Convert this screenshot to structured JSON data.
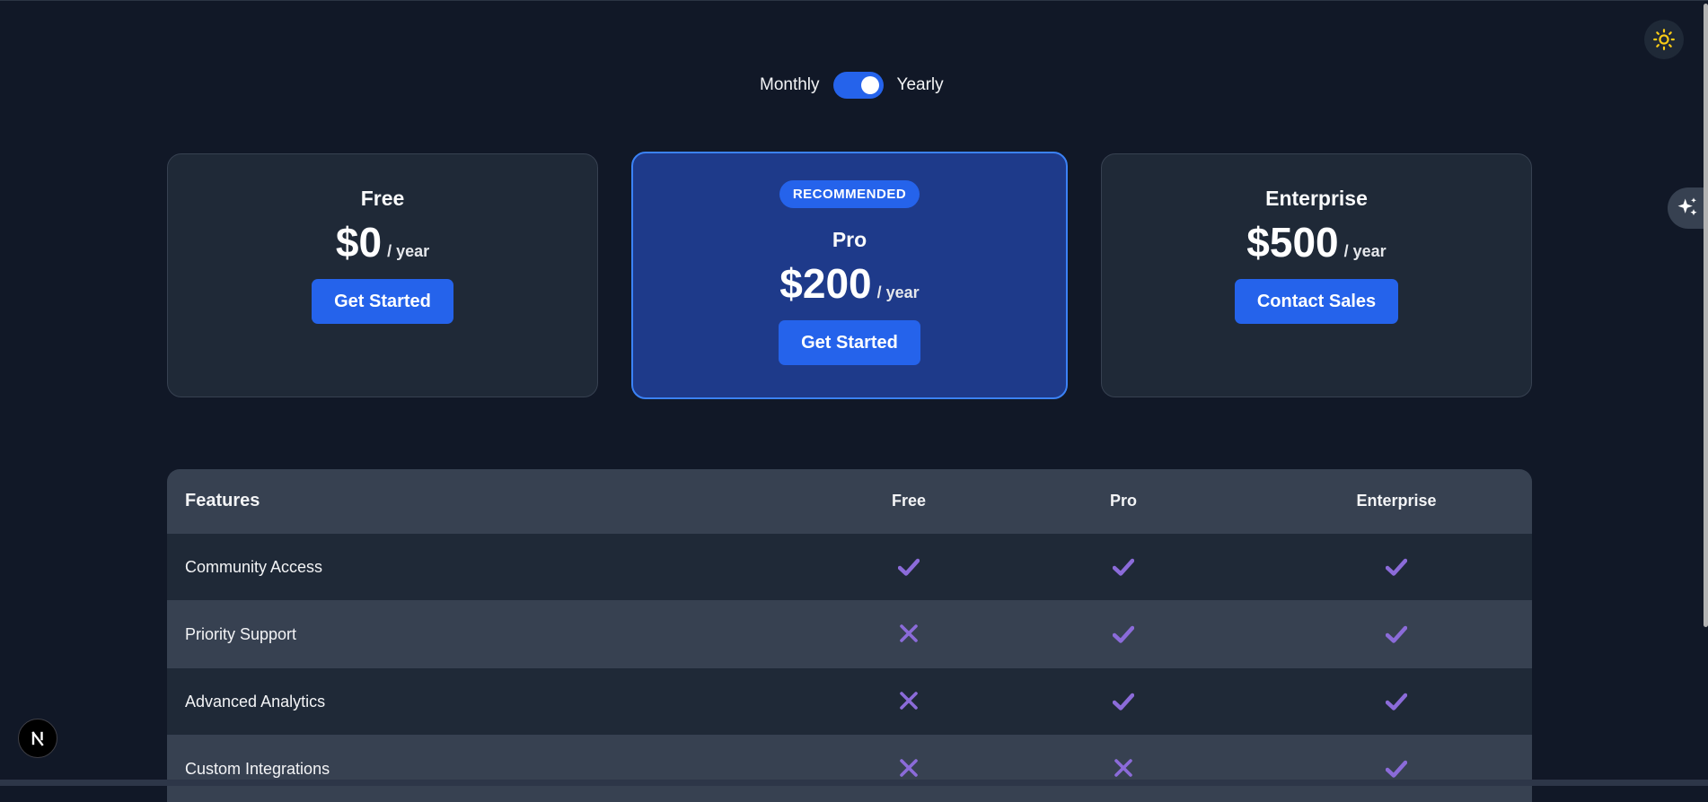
{
  "billing_toggle": {
    "left_label": "Monthly",
    "right_label": "Yearly",
    "yearly_selected": true
  },
  "colors": {
    "accent": "#2563eb",
    "background": "#111827",
    "card": "#1f2937",
    "recommended_card": "#1e3a8a",
    "icon_mark": "#8b6bd9",
    "sun": "#facc15"
  },
  "icons": {
    "theme": "sun-icon",
    "ai": "sparkles-icon",
    "next": "nextjs-logo-icon",
    "included": "check-icon",
    "excluded": "x-icon"
  },
  "plans": [
    {
      "name": "Free",
      "price": "$0",
      "period": "/ year",
      "cta": "Get Started"
    },
    {
      "badge": "RECOMMENDED",
      "name": "Pro",
      "price": "$200",
      "period": "/ year",
      "cta": "Get Started"
    },
    {
      "name": "Enterprise",
      "price": "$500",
      "period": "/ year",
      "cta": "Contact Sales"
    }
  ],
  "features_table": {
    "headers": [
      "Features",
      "Free",
      "Pro",
      "Enterprise"
    ],
    "rows": [
      {
        "feature": "Community Access",
        "free": true,
        "pro": true,
        "enterprise": true
      },
      {
        "feature": "Priority Support",
        "free": false,
        "pro": true,
        "enterprise": true
      },
      {
        "feature": "Advanced Analytics",
        "free": false,
        "pro": true,
        "enterprise": true
      },
      {
        "feature": "Custom Integrations",
        "free": false,
        "pro": false,
        "enterprise": true
      }
    ]
  }
}
